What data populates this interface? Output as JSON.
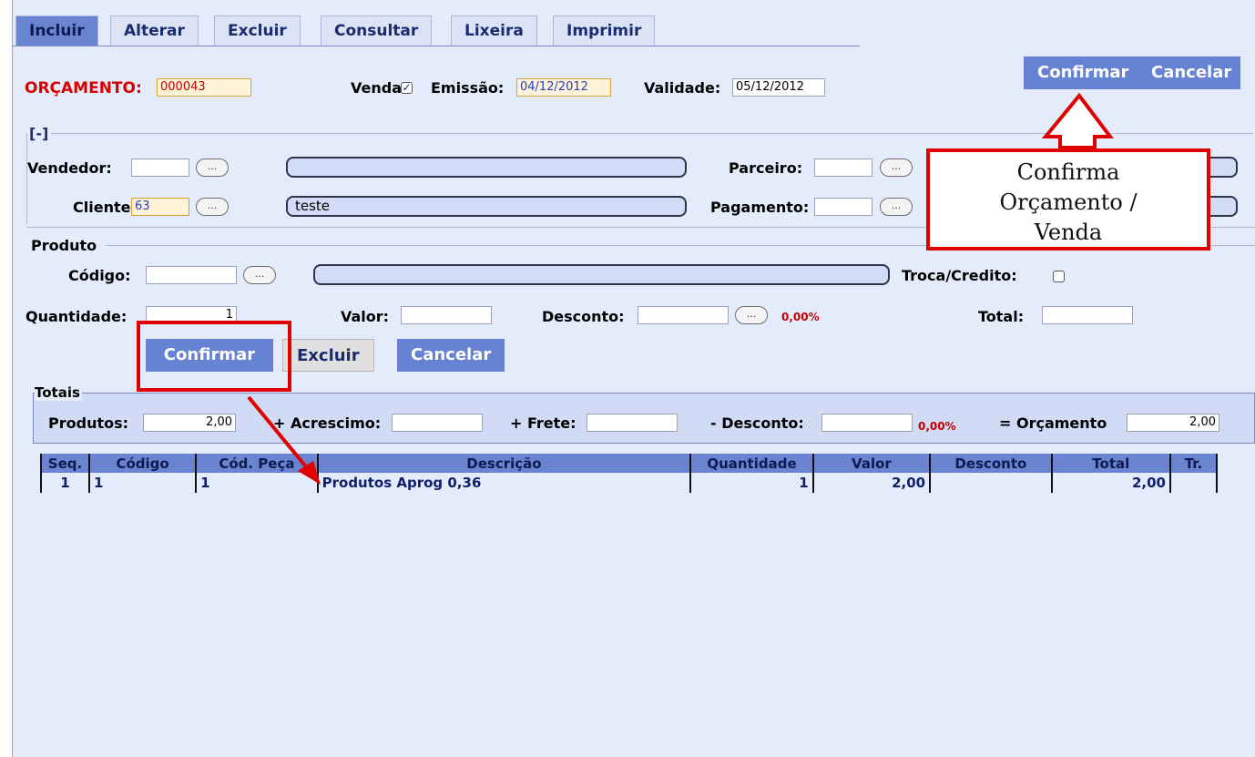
{
  "tabs": [
    "Incluir",
    "Alterar",
    "Excluir",
    "Consultar",
    "Lixeira",
    "Imprimir"
  ],
  "header": {
    "orcamento_label": "ORÇAMENTO:",
    "orcamento_value": "000043",
    "venda_label": "Venda:",
    "emissao_label": "Emissão:",
    "emissao_value": "04/12/2012",
    "validade_label": "Validade:",
    "validade_value": "05/12/2012",
    "confirmar": "Confirmar",
    "cancelar": "Cancelar"
  },
  "collapse_label": "[-]",
  "info": {
    "vendedor_label": "Vendedor:",
    "cliente_label": "Cliente:",
    "cliente_code": "63",
    "cliente_name": "teste",
    "parceiro_label": "Parceiro:",
    "pagamento_label": "Pagamento:",
    "dots": "..."
  },
  "produto": {
    "legend": "Produto",
    "codigo_label": "Código:",
    "troca_label": "Troca/Credito:",
    "quantidade_label": "Quantidade:",
    "quantidade_value": "1",
    "valor_label": "Valor:",
    "desconto_label": "Desconto:",
    "desconto_pct": "0,00%",
    "total_label": "Total:",
    "confirmar": "Confirmar",
    "excluir": "Excluir",
    "cancelar": "Cancelar"
  },
  "totais": {
    "legend": "Totais",
    "produtos_label": "Produtos:",
    "produtos_value": "2,00",
    "acrescimo_label": "+ Acrescimo:",
    "frete_label": "+ Frete:",
    "desconto_label": "- Desconto:",
    "desconto_pct": "0,00%",
    "orcamento_label": "= Orçamento",
    "orcamento_value": "2,00"
  },
  "table": {
    "headers": [
      "Seq.",
      "Código",
      "Cód. Peça",
      "Descrição",
      "Quantidade",
      "Valor",
      "Desconto",
      "Total",
      "Tr."
    ],
    "rows": [
      [
        "1",
        "1",
        "1",
        "Produtos Aprog 0,36",
        "1",
        "2,00",
        "",
        "2,00",
        ""
      ]
    ]
  },
  "annotation": {
    "line1": "Confirma",
    "line2": "Orçamento /",
    "line3": "Venda"
  },
  "colors": {
    "accent": "#6a84d1",
    "annotation_red": "#e00000",
    "label_red": "#d80000"
  }
}
